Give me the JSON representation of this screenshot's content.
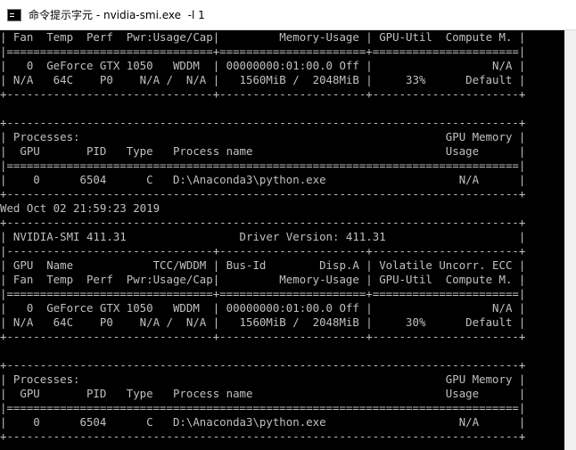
{
  "window": {
    "title": "命令提示字元 - nvidia-smi.exe  -l 1"
  },
  "console": {
    "lines": [
      "| Fan  Temp  Perf  Pwr:Usage/Cap|         Memory-Usage | GPU-Util  Compute M. |",
      "|===============================+======================+======================|",
      "|   0  GeForce GTX 1050   WDDM  | 00000000:01:00.0 Off |                  N/A |",
      "| N/A   64C    P0    N/A /  N/A |   1560MiB /  2048MiB |     33%      Default |",
      "+-------------------------------+----------------------+----------------------+",
      "",
      "+-----------------------------------------------------------------------------+",
      "| Processes:                                                       GPU Memory |",
      "|  GPU       PID   Type   Process name                             Usage      |",
      "|=============================================================================|",
      "|    0      6504      C   D:\\Anaconda3\\python.exe                    N/A      |",
      "+-----------------------------------------------------------------------------+",
      "Wed Oct 02 21:59:23 2019",
      "+-----------------------------------------------------------------------------+",
      "| NVIDIA-SMI 411.31                 Driver Version: 411.31                    |",
      "|-------------------------------+----------------------+----------------------+",
      "| GPU  Name            TCC/WDDM | Bus-Id        Disp.A | Volatile Uncorr. ECC |",
      "| Fan  Temp  Perf  Pwr:Usage/Cap|         Memory-Usage | GPU-Util  Compute M. |",
      "|===============================+======================+======================|",
      "|   0  GeForce GTX 1050   WDDM  | 00000000:01:00.0 Off |                  N/A |",
      "| N/A   64C    P0    N/A /  N/A |   1560MiB /  2048MiB |     30%      Default |",
      "+-------------------------------+----------------------+----------------------+",
      "",
      "+-----------------------------------------------------------------------------+",
      "| Processes:                                                       GPU Memory |",
      "|  GPU       PID   Type   Process name                             Usage      |",
      "|=============================================================================|",
      "|    0      6504      C   D:\\Anaconda3\\python.exe                    N/A      |",
      "+-----------------------------------------------------------------------------+"
    ]
  }
}
